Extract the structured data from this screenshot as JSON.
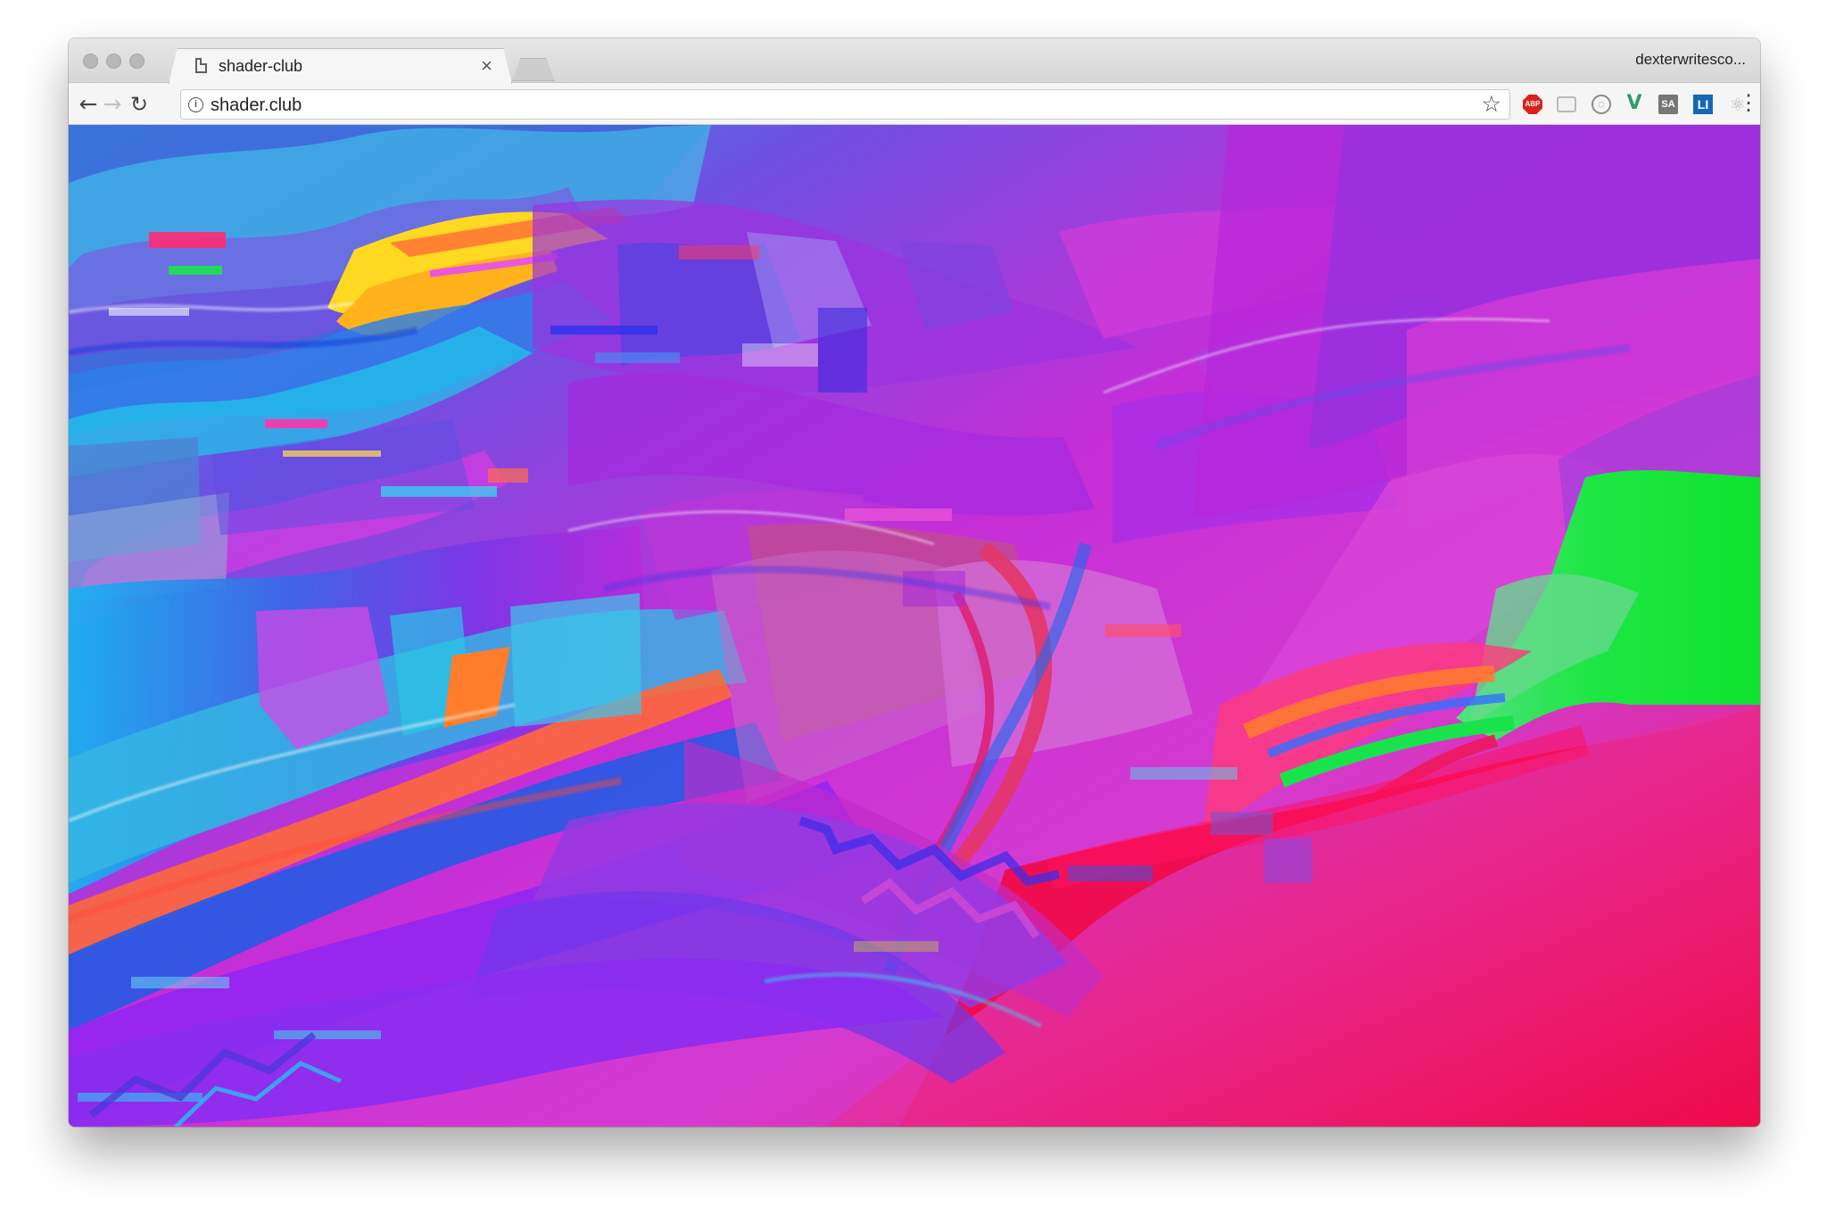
{
  "browser": {
    "tab_title": "shader-club",
    "profile_name": "dexterwritesco...",
    "url": "shader.club",
    "icons": {
      "back": "back-arrow-icon",
      "forward": "forward-arrow-icon",
      "reload": "reload-icon",
      "info": "site-info-icon",
      "bookmark": "star-icon",
      "menu": "vertical-ellipsis-icon",
      "new_tab": "new-tab-icon"
    },
    "extensions": [
      {
        "name": "adblock-plus-extension-icon",
        "label": "ABP"
      },
      {
        "name": "comment-extension-icon",
        "label": ""
      },
      {
        "name": "circle-extension-icon",
        "label": ""
      },
      {
        "name": "vue-devtools-extension-icon",
        "label": "V"
      },
      {
        "name": "sa-extension-icon",
        "label": "SA"
      },
      {
        "name": "linkedin-extension-icon",
        "label": "LI"
      },
      {
        "name": "react-devtools-extension-icon",
        "label": ""
      },
      {
        "name": "bookmark-extension-icon",
        "label": ""
      }
    ]
  },
  "page": {
    "content": "glitch-shader-artwork",
    "colors": {
      "magenta": "#d72bd2",
      "violet": "#8c2ee8",
      "blue": "#2f62e8",
      "cyan": "#35d7ea",
      "red": "#ef1055",
      "green": "#18e54a",
      "yellow": "#ffd21f",
      "orange": "#ff7a2f"
    }
  }
}
